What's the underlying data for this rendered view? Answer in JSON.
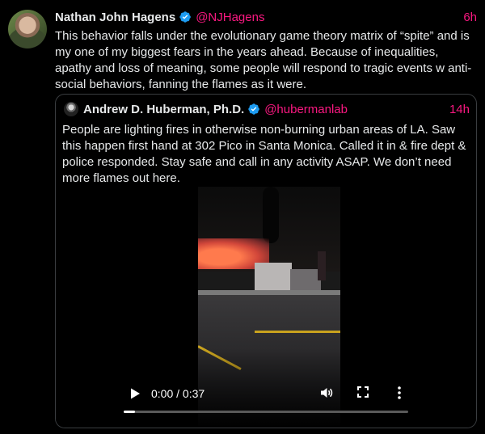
{
  "tweet": {
    "author_name": "Nathan John Hagens",
    "handle": "@NJHagens",
    "time": "6h",
    "text": "This behavior falls under the evolutionary game theory matrix of “spite” and is my one of my biggest fears in the years ahead.  Because of inequalities, apathy and loss of meaning, some people will respond to tragic events w anti-social behaviors, fanning the flames as it were."
  },
  "quote": {
    "author_name": "Andrew D. Huberman, Ph.D.",
    "handle": "@hubermanlab",
    "time": "14h",
    "text": "People are lighting fires in otherwise non-burning urban areas of LA. Saw this happen first hand at 302 Pico in Santa Monica. Called it in & fire dept & police responded. Stay safe and call in any activity ASAP. We don’t need more flames out here."
  },
  "video": {
    "time_display": "0:00 / 0:37",
    "progress": 0.04
  },
  "colors": {
    "accent": "#f91880",
    "verified": "#1d9bf0",
    "background": "#000000",
    "text": "#e7e9ea"
  },
  "icons": [
    "verified-badge-icon",
    "play-icon",
    "volume-icon",
    "fullscreen-icon",
    "more-options-icon"
  ]
}
